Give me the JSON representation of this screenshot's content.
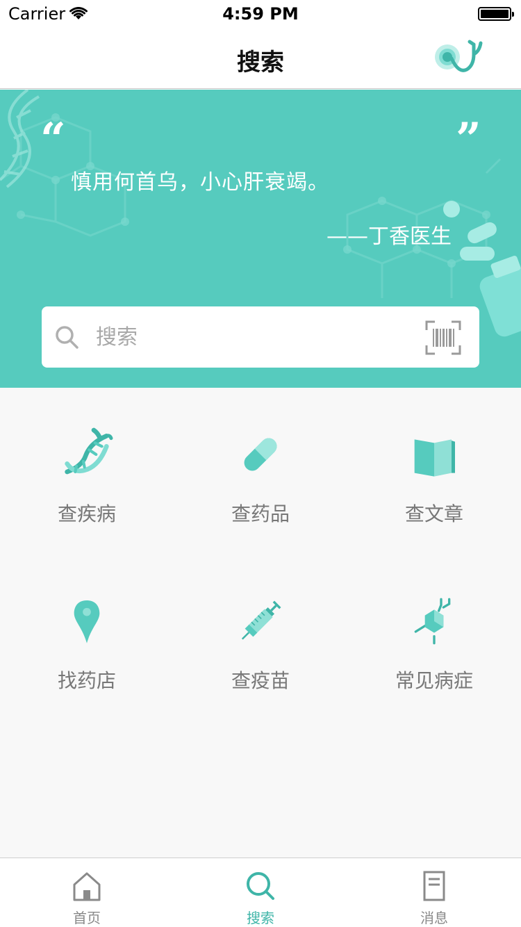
{
  "status_bar": {
    "carrier": "Carrier",
    "time": "4:59 PM"
  },
  "nav": {
    "title": "搜索",
    "right_icon": "stethoscope-icon"
  },
  "hero": {
    "quote_open": "“",
    "quote_close": "”",
    "quote": "慎用何首乌，小心肝衰竭。",
    "author": "——丁香医生"
  },
  "search": {
    "placeholder": "搜索",
    "left_icon": "search-icon",
    "right_icon": "barcode-scan-icon"
  },
  "grid": {
    "items": [
      {
        "label": "查疾病",
        "icon": "dna-icon"
      },
      {
        "label": "查药品",
        "icon": "pill-icon"
      },
      {
        "label": "查文章",
        "icon": "book-icon"
      },
      {
        "label": "找药店",
        "icon": "location-pin-icon"
      },
      {
        "label": "查疫苗",
        "icon": "syringe-icon"
      },
      {
        "label": "常见病症",
        "icon": "molecule-icon"
      }
    ]
  },
  "tab_bar": {
    "tabs": [
      {
        "label": "首页",
        "icon": "home-icon",
        "active": false
      },
      {
        "label": "搜索",
        "icon": "search-icon",
        "active": true
      },
      {
        "label": "消息",
        "icon": "message-doc-icon",
        "active": false
      }
    ]
  },
  "colors": {
    "accent": "#56cbbe",
    "accent_dark": "#3fb5a8",
    "text_muted": "#777777",
    "background": "#f8f8f8"
  }
}
